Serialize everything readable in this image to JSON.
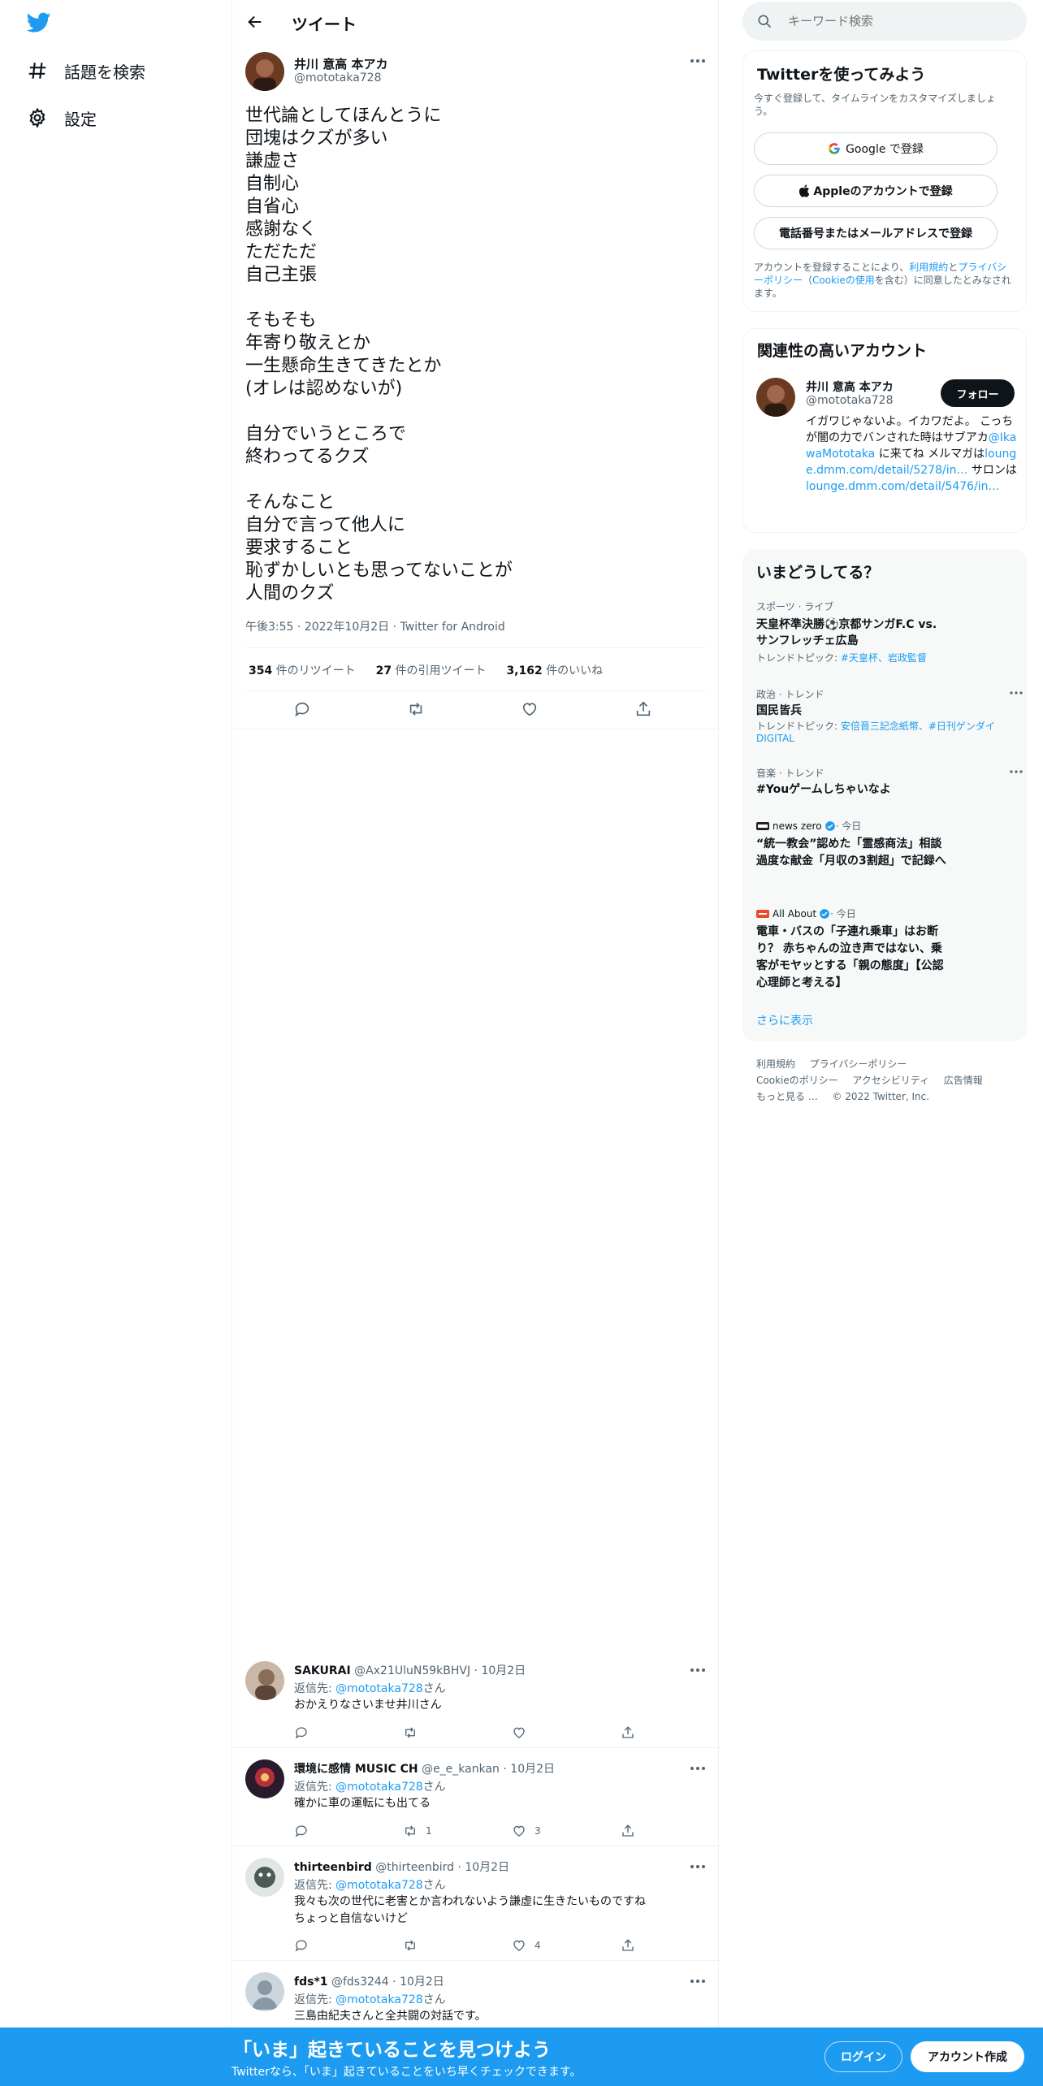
{
  "colors": {
    "accent": "#1d9bf0",
    "text": "#0f1419",
    "muted": "#536471",
    "bar": "#1d9bf0"
  },
  "nav": {
    "items": [
      {
        "label": "話題を検索",
        "icon": "hashtag-icon"
      },
      {
        "label": "設定",
        "icon": "gear-icon"
      }
    ]
  },
  "header": {
    "title": "ツイート"
  },
  "tweet": {
    "author_name": "井川 意高 本アカ",
    "handle": "@mototaka728",
    "text": "世代論としてほんとうに\n団塊はクズが多い\n謙虚さ\n自制心\n自省心\n感謝なく\nただただ\n自己主張\n\nそもそも\n年寄り敬えとか\n一生懸命生きてきたとか\n(オレは認めないが)\n\n自分でいうところで\n終わってるクズ\n\nそんなこと\n自分で言って他人に\n要求すること\n恥ずかしいとも思ってないことが\n人間のクズ",
    "time": "午後3:55",
    "date": "2022年10月2日",
    "source": "Twitter for Android",
    "retweets_count": "354",
    "retweets_label": "件のリツイート",
    "quotes_count": "27",
    "quotes_label": "件の引用ツイート",
    "likes_count": "3,162",
    "likes_label": "件のいいね"
  },
  "replies": [
    {
      "name": "SAKURAI",
      "handle": "@Ax21UluN59kBHVJ",
      "date": "10月2日",
      "reply_to_label": "返信先: ",
      "reply_to_handle": "@mototaka728",
      "reply_to_suffix": "さん",
      "text": "おかえりなさいませ井川さん",
      "retweets": "",
      "likes": ""
    },
    {
      "name": "環境に感情 MUSIC CH",
      "handle": "@e_e_kankan",
      "date": "10月2日",
      "reply_to_label": "返信先: ",
      "reply_to_handle": "@mototaka728",
      "reply_to_suffix": "さん",
      "text": "確かに車の運転にも出てる",
      "retweets": "1",
      "likes": "3"
    },
    {
      "name": "thirteenbird",
      "handle": "@thirteenbird",
      "date": "10月2日",
      "reply_to_label": "返信先: ",
      "reply_to_handle": "@mototaka728",
      "reply_to_suffix": "さん",
      "text": "我々も次の世代に老害とか言われないよう謙虚に生きたいものですね\nちょっと自信ないけど",
      "retweets": "",
      "likes": "4"
    },
    {
      "name": "fds*1",
      "handle": "@fds3244",
      "date": "10月2日",
      "reply_to_label": "返信先: ",
      "reply_to_handle": "@mototaka728",
      "reply_to_suffix": "さん",
      "text": "三島由紀夫さんと全共闘の対話です。",
      "retweets": "",
      "likes": ""
    }
  ],
  "search": {
    "placeholder": "キーワード検索"
  },
  "signup": {
    "title": "Twitterを使ってみよう",
    "subtitle": "今すぐ登録して、タイムラインをカスタマイズしましょう。",
    "google_button": "Google で登録",
    "apple_button": "Appleのアカウントで登録",
    "phone_button": "電話番号またはメールアドレスで登録",
    "terms_prefix": "アカウントを登録することにより、",
    "terms_link": "利用規約",
    "terms_and": "と",
    "privacy_link": "プライバシーポリシー",
    "cookie_open": "（",
    "cookie_link": "Cookieの使用",
    "terms_suffix": "を含む）に同意したとみなされます。"
  },
  "related": {
    "title": "関連性の高いアカウント",
    "name": "井川 意高 本アカ",
    "handle": "@mototaka728",
    "follow_button": "フォロー",
    "bio_1": "イガワじゃないよ。イカワだよ。 こっちが闇の力でバンされた時はサブアカ",
    "bio_mention": "@IkawaMototaka",
    "bio_2": " に来てね メルマガは",
    "bio_link1": "lounge.dmm.com/detail/5278/in…",
    "bio_3": " サロンは",
    "bio_link2": "lounge.dmm.com/detail/5476/in…"
  },
  "trends": {
    "title": "いまどうしてる？",
    "items": [
      {
        "meta": "スポーツ · ライブ",
        "title": "天皇杯準決勝⚽京都サンガF.C vs. サンフレッチェ広島",
        "topics_label": "トレンドトピック: ",
        "topics": "#天皇杯、岩政監督",
        "has_more": false
      },
      {
        "meta": "政治 · トレンド",
        "title": "国民皆兵",
        "topics_label": "トレンドトピック: ",
        "topics": "安倍晋三記念紙幣、#日刊ゲンダイDIGITAL",
        "has_more": true
      },
      {
        "meta": "音楽 · トレンド",
        "title": "#Youゲームしちゃいなよ",
        "topics_label": "",
        "topics": "",
        "has_more": true
      }
    ],
    "news": [
      {
        "source": "news zero",
        "when": " · 今日",
        "title": "“統一教会”認めた「霊感商法」相談　過度な献金「月収の3割超」で記録へ"
      },
      {
        "source": "All About",
        "when": " · 今日",
        "title": "電車・バスの「子連れ乗車」はお断り？ 赤ちゃんの泣き声ではない、乗客がモヤッとする「親の態度」【公認心理師と考える】"
      }
    ],
    "show_more": "さらに表示"
  },
  "footer": {
    "links": [
      "利用規約",
      "プライバシーポリシー",
      "Cookieのポリシー",
      "アクセシビリティ",
      "広告情報",
      "もっと見る …"
    ],
    "copyright": "© 2022 Twitter, Inc."
  },
  "bottom": {
    "title": "「いま」起きていることを見つけよう",
    "subtitle": "Twitterなら、「いま」起きていることをいち早くチェックできます。",
    "login": "ログイン",
    "signup": "アカウント作成"
  }
}
